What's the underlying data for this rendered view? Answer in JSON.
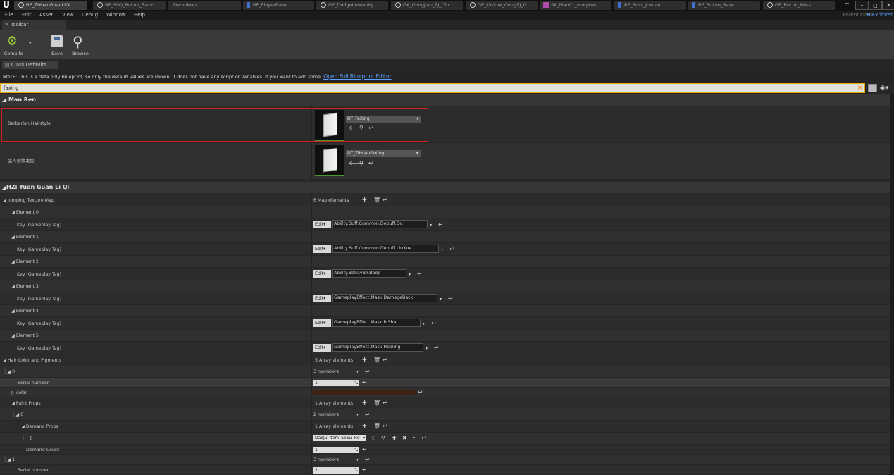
{
  "tabs": [
    "BP_ZiYuanGuanLiQi",
    "BP_SSQ_BuLuo_Bas+",
    "DemoMap",
    "BP_PlayerBase",
    "GE_DodgeImmunity",
    "GA_GongJian_ZJ_Chr.",
    "GE_LiuXue_GongZJ_0",
    "SK_Man01_morpher",
    "BP_Boss_JuYuan",
    "BP_BuLuo_Base",
    "GE_BuLuo_Boss"
  ],
  "menu": [
    "File",
    "Edit",
    "Asset",
    "View",
    "Debug",
    "Window",
    "Help"
  ],
  "parent_class_label": "Parent class:",
  "parent_class_value": "H Explorer",
  "toolbar_tab": "Toolbar",
  "toolbar": {
    "compile": "Compile",
    "save": "Save",
    "browse": "Browse"
  },
  "class_defaults_tab": "Class Defaults",
  "note": {
    "text": "NOTE: This is a data only blueprint, so only the default values are shown.  It does not have any script or variables.  If you want to add some,",
    "link": "Open Full Blueprint Editor"
  },
  "search": {
    "value": "faxing"
  },
  "categories": {
    "man_ren": "Man Ren",
    "hzi": "HZi Yuan Guan Li Qi"
  },
  "man_ren": {
    "hairstyle_label": "Barbarian Hairstyle",
    "hairstyle_asset": "DT_FaXing",
    "replace_label": "蛮人替换发型",
    "replace_asset": "DT_TiHuanFaXing"
  },
  "jumping": {
    "label": "Jumping Texture Map",
    "count": "6 Map elements",
    "key_label": "Key (Gameplay Tag)",
    "edit_label": "Edit",
    "elements": [
      {
        "name": "Element 0",
        "tag": "Ability.Buff.Common.Debuff.Du"
      },
      {
        "name": "Element 1",
        "tag": "Ability.Buff.Common.Debuff.LiuXue"
      },
      {
        "name": "Element 2",
        "tag": "Ability.Behavior.BaoJi"
      },
      {
        "name": "Element 3",
        "tag": "GameplayEffect.Mask.DamageBack"
      },
      {
        "name": "Element 4",
        "tag": "GameplayEffect.Mask.BiSha"
      },
      {
        "name": "Element 5",
        "tag": "GameplayEffect.Mask.Healing"
      }
    ]
  },
  "hair": {
    "label": "Hair Color and Pigments",
    "count": "5 Array elements",
    "i0": "0",
    "i0_members": "3 members",
    "serial_label": "Serial number",
    "serial0": "1",
    "color_label": "color",
    "color_hex": "#3d2010",
    "paint_label": "Paint Props",
    "paint_count": "1 Array elements",
    "pp0": "0",
    "pp0_members": "2 members",
    "demand_label": "Demand Props",
    "demand_count": "1 Array elements",
    "dp0": "0",
    "dp0_value": "DaoJu_Item_SeSu_He",
    "demand_count_label": "Demand Count",
    "demand_count_value": "1",
    "i1": "1",
    "i1_members": "3 members",
    "serial1": "2"
  }
}
